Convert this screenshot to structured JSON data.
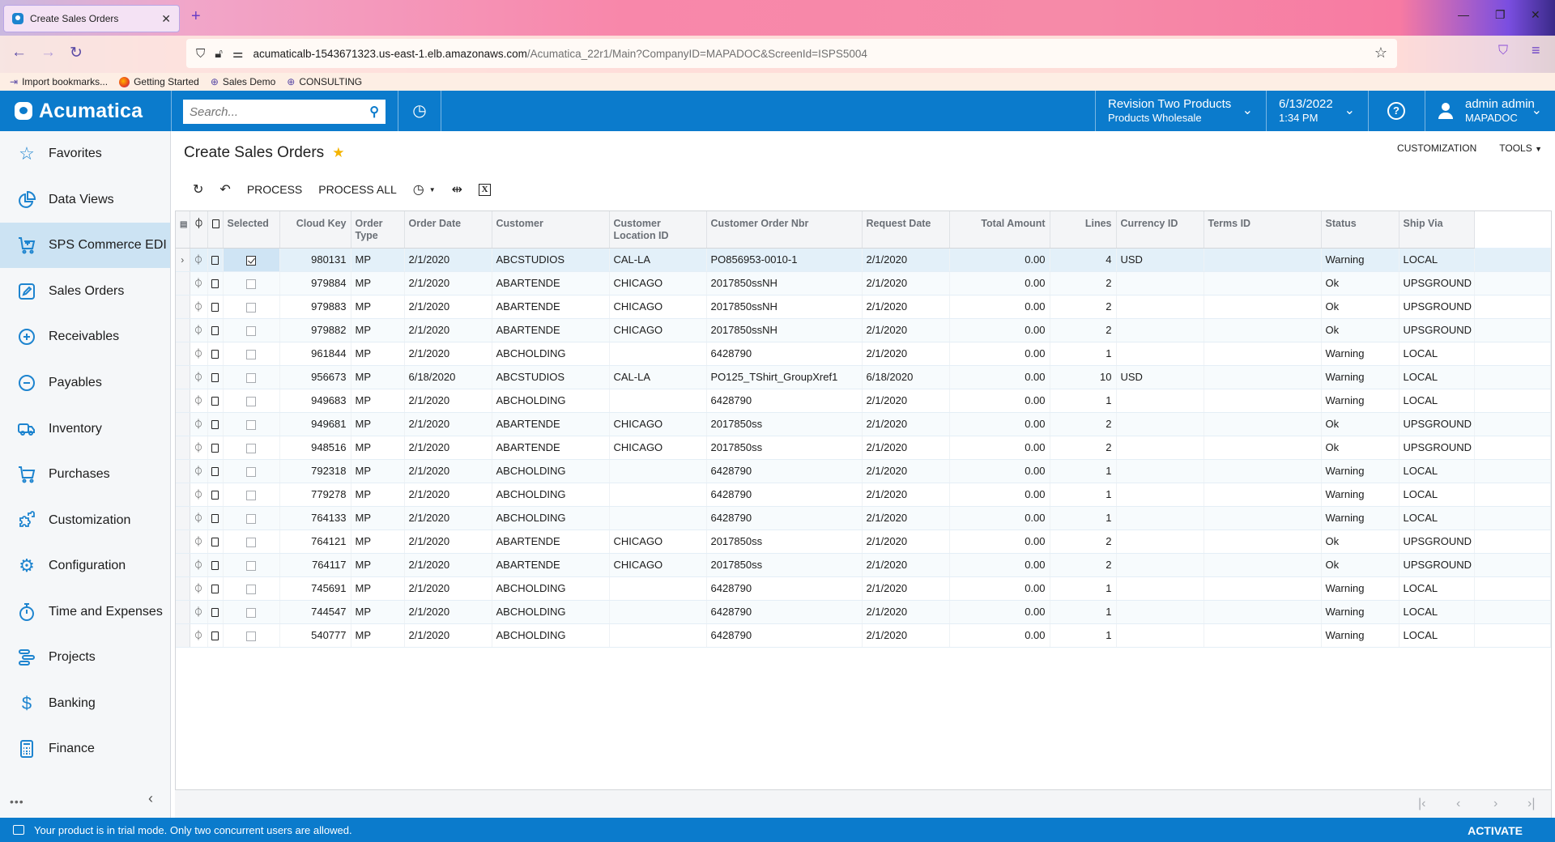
{
  "browser": {
    "tab_title": "Create Sales Orders",
    "url_host": "acumaticalb-1543671323.us-east-1.elb.amazonaws.com",
    "url_path": "/Acumatica_22r1/Main?CompanyID=MAPADOC&ScreenId=ISPS5004",
    "bookmarks": [
      {
        "label": "Import bookmarks...",
        "icon": "import-icon"
      },
      {
        "label": "Getting Started",
        "icon": "firefox-icon"
      },
      {
        "label": "Sales Demo",
        "icon": "globe-icon"
      },
      {
        "label": "CONSULTING",
        "icon": "globe-icon"
      }
    ]
  },
  "header": {
    "logo": "Acumatica",
    "search_placeholder": "Search...",
    "company_line1": "Revision Two Products",
    "company_line2": "Products Wholesale",
    "date": "6/13/2022",
    "time": "1:34 PM",
    "user_name": "admin admin",
    "user_company": "MAPADOC",
    "accent_color": "#0b7bcc"
  },
  "sidebar": {
    "items": [
      {
        "label": "Favorites",
        "icon": "star-icon"
      },
      {
        "label": "Data Views",
        "icon": "pie-chart-icon"
      },
      {
        "label": "SPS Commerce EDI",
        "icon": "cart-plus-icon",
        "active": true
      },
      {
        "label": "Sales Orders",
        "icon": "edit-icon"
      },
      {
        "label": "Receivables",
        "icon": "plus-circle-icon"
      },
      {
        "label": "Payables",
        "icon": "minus-circle-icon"
      },
      {
        "label": "Inventory",
        "icon": "truck-icon"
      },
      {
        "label": "Purchases",
        "icon": "cart-icon"
      },
      {
        "label": "Customization",
        "icon": "puzzle-icon"
      },
      {
        "label": "Configuration",
        "icon": "gear-icon"
      },
      {
        "label": "Time and Expenses",
        "icon": "stopwatch-icon"
      },
      {
        "label": "Projects",
        "icon": "projects-icon"
      },
      {
        "label": "Banking",
        "icon": "dollar-icon"
      },
      {
        "label": "Finance",
        "icon": "calculator-icon"
      }
    ],
    "more": "•••"
  },
  "page": {
    "title": "Create Sales Orders",
    "customization": "CUSTOMIZATION",
    "tools": "TOOLS",
    "toolbar": {
      "process": "PROCESS",
      "process_all": "PROCESS ALL"
    }
  },
  "grid": {
    "columns": [
      "Selected",
      "Cloud Key",
      "Order Type",
      "Order Date",
      "Customer",
      "Customer Location ID",
      "Customer Order Nbr",
      "Request Date",
      "Total Amount",
      "Lines",
      "Currency ID",
      "Terms ID",
      "Status",
      "Ship Via"
    ],
    "rows": [
      {
        "selected": true,
        "cloud_key": "980131",
        "order_type": "MP",
        "order_date": "2/1/2020",
        "customer": "ABCSTUDIOS",
        "location": "CAL-LA",
        "cust_order_nbr": "PO856953-0010-1",
        "request_date": "2/1/2020",
        "total": "0.00",
        "lines": "4",
        "currency": "USD",
        "terms": "",
        "status": "Warning",
        "ship_via": "LOCAL"
      },
      {
        "selected": false,
        "cloud_key": "979884",
        "order_type": "MP",
        "order_date": "2/1/2020",
        "customer": "ABARTENDE",
        "location": "CHICAGO",
        "cust_order_nbr": "2017850ssNH",
        "request_date": "2/1/2020",
        "total": "0.00",
        "lines": "2",
        "currency": "",
        "terms": "",
        "status": "Ok",
        "ship_via": "UPSGROUND"
      },
      {
        "selected": false,
        "cloud_key": "979883",
        "order_type": "MP",
        "order_date": "2/1/2020",
        "customer": "ABARTENDE",
        "location": "CHICAGO",
        "cust_order_nbr": "2017850ssNH",
        "request_date": "2/1/2020",
        "total": "0.00",
        "lines": "2",
        "currency": "",
        "terms": "",
        "status": "Ok",
        "ship_via": "UPSGROUND"
      },
      {
        "selected": false,
        "cloud_key": "979882",
        "order_type": "MP",
        "order_date": "2/1/2020",
        "customer": "ABARTENDE",
        "location": "CHICAGO",
        "cust_order_nbr": "2017850ssNH",
        "request_date": "2/1/2020",
        "total": "0.00",
        "lines": "2",
        "currency": "",
        "terms": "",
        "status": "Ok",
        "ship_via": "UPSGROUND"
      },
      {
        "selected": false,
        "cloud_key": "961844",
        "order_type": "MP",
        "order_date": "2/1/2020",
        "customer": "ABCHOLDING",
        "location": "",
        "cust_order_nbr": "6428790",
        "request_date": "2/1/2020",
        "total": "0.00",
        "lines": "1",
        "currency": "",
        "terms": "",
        "status": "Warning",
        "ship_via": "LOCAL"
      },
      {
        "selected": false,
        "cloud_key": "956673",
        "order_type": "MP",
        "order_date": "6/18/2020",
        "customer": "ABCSTUDIOS",
        "location": "CAL-LA",
        "cust_order_nbr": "PO125_TShirt_GroupXref1",
        "request_date": "6/18/2020",
        "total": "0.00",
        "lines": "10",
        "currency": "USD",
        "terms": "",
        "status": "Warning",
        "ship_via": "LOCAL"
      },
      {
        "selected": false,
        "cloud_key": "949683",
        "order_type": "MP",
        "order_date": "2/1/2020",
        "customer": "ABCHOLDING",
        "location": "",
        "cust_order_nbr": "6428790",
        "request_date": "2/1/2020",
        "total": "0.00",
        "lines": "1",
        "currency": "",
        "terms": "",
        "status": "Warning",
        "ship_via": "LOCAL"
      },
      {
        "selected": false,
        "cloud_key": "949681",
        "order_type": "MP",
        "order_date": "2/1/2020",
        "customer": "ABARTENDE",
        "location": "CHICAGO",
        "cust_order_nbr": "2017850ss",
        "request_date": "2/1/2020",
        "total": "0.00",
        "lines": "2",
        "currency": "",
        "terms": "",
        "status": "Ok",
        "ship_via": "UPSGROUND"
      },
      {
        "selected": false,
        "cloud_key": "948516",
        "order_type": "MP",
        "order_date": "2/1/2020",
        "customer": "ABARTENDE",
        "location": "CHICAGO",
        "cust_order_nbr": "2017850ss",
        "request_date": "2/1/2020",
        "total": "0.00",
        "lines": "2",
        "currency": "",
        "terms": "",
        "status": "Ok",
        "ship_via": "UPSGROUND"
      },
      {
        "selected": false,
        "cloud_key": "792318",
        "order_type": "MP",
        "order_date": "2/1/2020",
        "customer": "ABCHOLDING",
        "location": "",
        "cust_order_nbr": "6428790",
        "request_date": "2/1/2020",
        "total": "0.00",
        "lines": "1",
        "currency": "",
        "terms": "",
        "status": "Warning",
        "ship_via": "LOCAL"
      },
      {
        "selected": false,
        "cloud_key": "779278",
        "order_type": "MP",
        "order_date": "2/1/2020",
        "customer": "ABCHOLDING",
        "location": "",
        "cust_order_nbr": "6428790",
        "request_date": "2/1/2020",
        "total": "0.00",
        "lines": "1",
        "currency": "",
        "terms": "",
        "status": "Warning",
        "ship_via": "LOCAL"
      },
      {
        "selected": false,
        "cloud_key": "764133",
        "order_type": "MP",
        "order_date": "2/1/2020",
        "customer": "ABCHOLDING",
        "location": "",
        "cust_order_nbr": "6428790",
        "request_date": "2/1/2020",
        "total": "0.00",
        "lines": "1",
        "currency": "",
        "terms": "",
        "status": "Warning",
        "ship_via": "LOCAL"
      },
      {
        "selected": false,
        "cloud_key": "764121",
        "order_type": "MP",
        "order_date": "2/1/2020",
        "customer": "ABARTENDE",
        "location": "CHICAGO",
        "cust_order_nbr": "2017850ss",
        "request_date": "2/1/2020",
        "total": "0.00",
        "lines": "2",
        "currency": "",
        "terms": "",
        "status": "Ok",
        "ship_via": "UPSGROUND"
      },
      {
        "selected": false,
        "cloud_key": "764117",
        "order_type": "MP",
        "order_date": "2/1/2020",
        "customer": "ABARTENDE",
        "location": "CHICAGO",
        "cust_order_nbr": "2017850ss",
        "request_date": "2/1/2020",
        "total": "0.00",
        "lines": "2",
        "currency": "",
        "terms": "",
        "status": "Ok",
        "ship_via": "UPSGROUND"
      },
      {
        "selected": false,
        "cloud_key": "745691",
        "order_type": "MP",
        "order_date": "2/1/2020",
        "customer": "ABCHOLDING",
        "location": "",
        "cust_order_nbr": "6428790",
        "request_date": "2/1/2020",
        "total": "0.00",
        "lines": "1",
        "currency": "",
        "terms": "",
        "status": "Warning",
        "ship_via": "LOCAL"
      },
      {
        "selected": false,
        "cloud_key": "744547",
        "order_type": "MP",
        "order_date": "2/1/2020",
        "customer": "ABCHOLDING",
        "location": "",
        "cust_order_nbr": "6428790",
        "request_date": "2/1/2020",
        "total": "0.00",
        "lines": "1",
        "currency": "",
        "terms": "",
        "status": "Warning",
        "ship_via": "LOCAL"
      },
      {
        "selected": false,
        "cloud_key": "540777",
        "order_type": "MP",
        "order_date": "2/1/2020",
        "customer": "ABCHOLDING",
        "location": "",
        "cust_order_nbr": "6428790",
        "request_date": "2/1/2020",
        "total": "0.00",
        "lines": "1",
        "currency": "",
        "terms": "",
        "status": "Warning",
        "ship_via": "LOCAL"
      }
    ]
  },
  "status_bar": {
    "message": "Your product is in trial mode. Only two concurrent users are allowed.",
    "activate": "ACTIVATE"
  }
}
